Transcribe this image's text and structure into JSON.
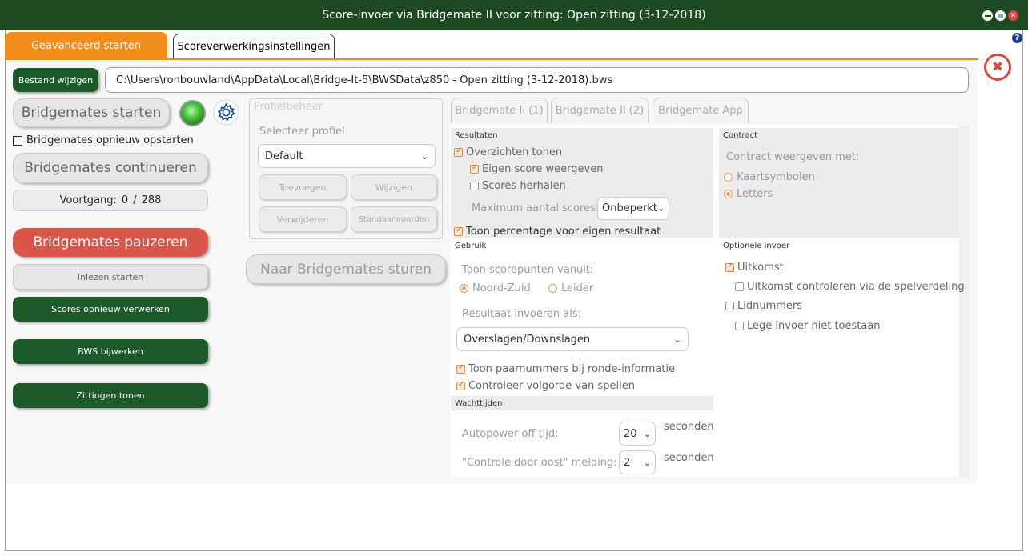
{
  "window": {
    "title": "Score-invoer via Bridgemate II voor zitting: Open zitting (3-12-2018)"
  },
  "tabs": [
    {
      "label": "Geavanceerd starten"
    },
    {
      "label": "Scoreverwerkingsinstellingen"
    }
  ],
  "file": {
    "change_button": "Bestand wijzigen",
    "path": "C:\\Users\\ronbouwland\\AppData\\Local\\Bridge-It-5\\BWSData\\z850 - Open zitting (3-12-2018).bws"
  },
  "left": {
    "start_button": "Bridgemates starten",
    "restart_checkbox": "Bridgemates opnieuw opstarten",
    "continue_button": "Bridgemates continueren",
    "progress_label": "Voortgang:",
    "progress_done": "0",
    "progress_sep": "/",
    "progress_total": "288",
    "pause_button": "Bridgemates pauzeren",
    "read_button": "Inlezen starten",
    "reprocess_button": "Scores opnieuw verwerken",
    "bws_button": "BWS bijwerken",
    "sessions_button": "Zittingen tonen"
  },
  "profile": {
    "title": "Profielbeheer",
    "select_label": "Selecteer profiel",
    "selected": "Default",
    "add": "Toevoegen",
    "edit": "Wijzigen",
    "delete": "Verwijderen",
    "defaults": "Standaarwaarden",
    "send_button": "Naar Bridgemates sturen"
  },
  "bm_tabs": [
    "Bridgemate II (1)",
    "Bridgemate II (2)",
    "Bridgemate App"
  ],
  "results": {
    "header": "Resultaten",
    "show_overview": "Overzichten tonen",
    "own_score": "Eigen score weergeven",
    "repeat_scores": "Scores herhalen",
    "max_scores_label": "Maximum aantal scores:",
    "max_scores_value": "Onbeperkt",
    "show_percentage": "Toon percentage voor eigen resultaat"
  },
  "usage": {
    "header": "Gebruik",
    "score_points_label": "Toon scorepunten vanuit:",
    "north_south": "Noord-Zuid",
    "leader": "Leider",
    "enter_as_label": "Resultaat invoeren als:",
    "enter_as_value": "Overslagen/Downslagen",
    "show_pair_numbers": "Toon paarnummers bij ronde-informatie",
    "check_order": "Controleer volgorde van spellen"
  },
  "wait": {
    "header": "Wachttijden",
    "autopower_label": "Autopower-off tijd:",
    "autopower_value": "20",
    "autopower_unit": "seconden",
    "east_label": "\"Controle door oost\" melding:",
    "east_value": "2",
    "east_unit": "seconden"
  },
  "contract": {
    "header": "Contract",
    "show_with_label": "Contract weergeven met:",
    "card_symbols": "Kaartsymbolen",
    "letters": "Letters"
  },
  "optional": {
    "header": "Optionele invoer",
    "outcome": "Uitkomst",
    "check_outcome": "Uitkomst controleren via de spelverdeling",
    "member_numbers": "Lidnummers",
    "no_empty": "Lege invoer niet toestaan"
  },
  "colors": {
    "titlebar": "#1d4a22",
    "accent_orange": "#f28d1b",
    "pause_red": "#d9574a",
    "green_button": "#1d5a2a"
  }
}
